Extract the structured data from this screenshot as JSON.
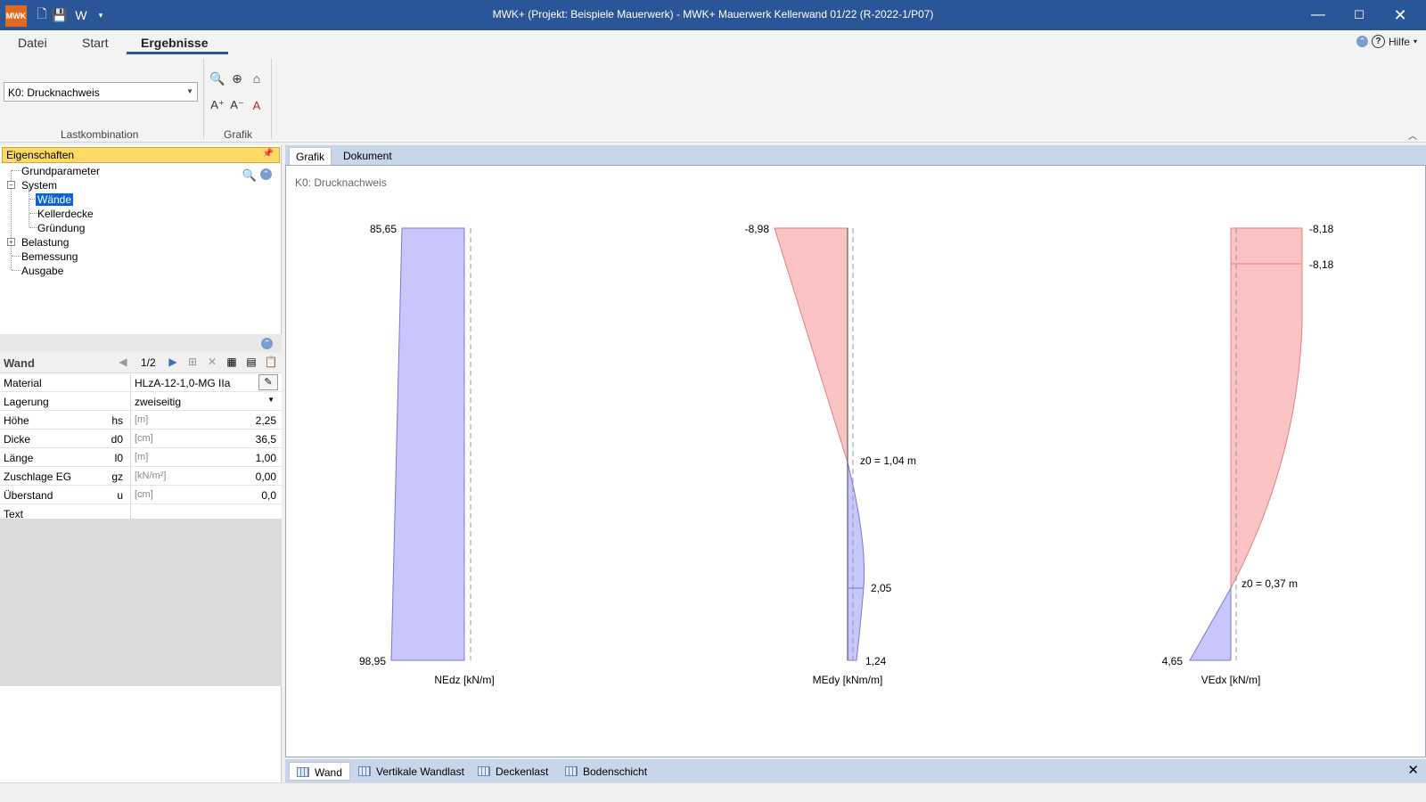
{
  "app": {
    "logo_text": "MWK",
    "title": "MWK+ (Projekt: Beispiele Mauerwerk) - MWK+ Mauerwerk Kellerwand 01/22 (R-2022-1/P07)"
  },
  "ribbon": {
    "tabs": [
      {
        "label": "Datei"
      },
      {
        "label": "Start"
      },
      {
        "label": "Ergebnisse"
      }
    ],
    "active_tab": "Ergebnisse",
    "help_label": "Hilfe",
    "lastkombination": {
      "selected": "K0: Drucknachweis",
      "group_label": "Lastkombination"
    },
    "grafik_group_label": "Grafik"
  },
  "properties_panel": {
    "header": "Eigenschaften",
    "tree": [
      {
        "label": "Grundparameter"
      },
      {
        "label": "System"
      },
      {
        "label": "Wände"
      },
      {
        "label": "Kellerdecke"
      },
      {
        "label": "Gründung"
      },
      {
        "label": "Belastung"
      },
      {
        "label": "Bemessung"
      },
      {
        "label": "Ausgabe"
      }
    ],
    "selected_item": "Wände"
  },
  "wand": {
    "label": "Wand",
    "page": "1/2",
    "rows": [
      {
        "name": "Material",
        "sym": "",
        "unit": "",
        "value": "HLzA-12-1,0-MG IIa"
      },
      {
        "name": "Lagerung",
        "sym": "",
        "unit": "",
        "value": "zweiseitig"
      },
      {
        "name": "Höhe",
        "sym": "hs",
        "unit": "[m]",
        "value": "2,25"
      },
      {
        "name": "Dicke",
        "sym": "d0",
        "unit": "[cm]",
        "value": "36,5"
      },
      {
        "name": "Länge",
        "sym": "l0",
        "unit": "[m]",
        "value": "1,00"
      },
      {
        "name": "Zuschlage EG",
        "sym": "gz",
        "unit": "[kN/m²]",
        "value": "0,00"
      },
      {
        "name": "Überstand",
        "sym": "u",
        "unit": "[cm]",
        "value": "0,0"
      },
      {
        "name": "Text",
        "sym": "",
        "unit": "",
        "value": ""
      }
    ]
  },
  "document_tabs": [
    {
      "label": "Grafik"
    },
    {
      "label": "Dokument"
    }
  ],
  "active_document_tab": "Grafik",
  "graphic": {
    "caption": "K0: Drucknachweis",
    "nedz": {
      "axis_label": "NEdz [kN/m]",
      "top": "85,65",
      "bottom": "98,95"
    },
    "medy": {
      "axis_label": "MEdy [kNm/m]",
      "top": "-8,98",
      "zero": "z0 = 1,04 m",
      "mid": "2,05",
      "bottom": "1,24"
    },
    "vedx": {
      "axis_label": "VEdx [kN/m]",
      "top1": "-8,18",
      "top2": "-8,18",
      "zero": "z0 = 0,37 m",
      "bottom": "4,65"
    },
    "colors": {
      "positive": "#c8c6fa",
      "negative": "#fbc3c3",
      "outline_pos": "#7c76d6",
      "outline_neg": "#e08080"
    }
  },
  "bottom_tabs": [
    {
      "label": "Wand"
    },
    {
      "label": "Vertikale Wandlast"
    },
    {
      "label": "Deckenlast"
    },
    {
      "label": "Bodenschicht"
    }
  ],
  "active_bottom_tab": "Wand"
}
